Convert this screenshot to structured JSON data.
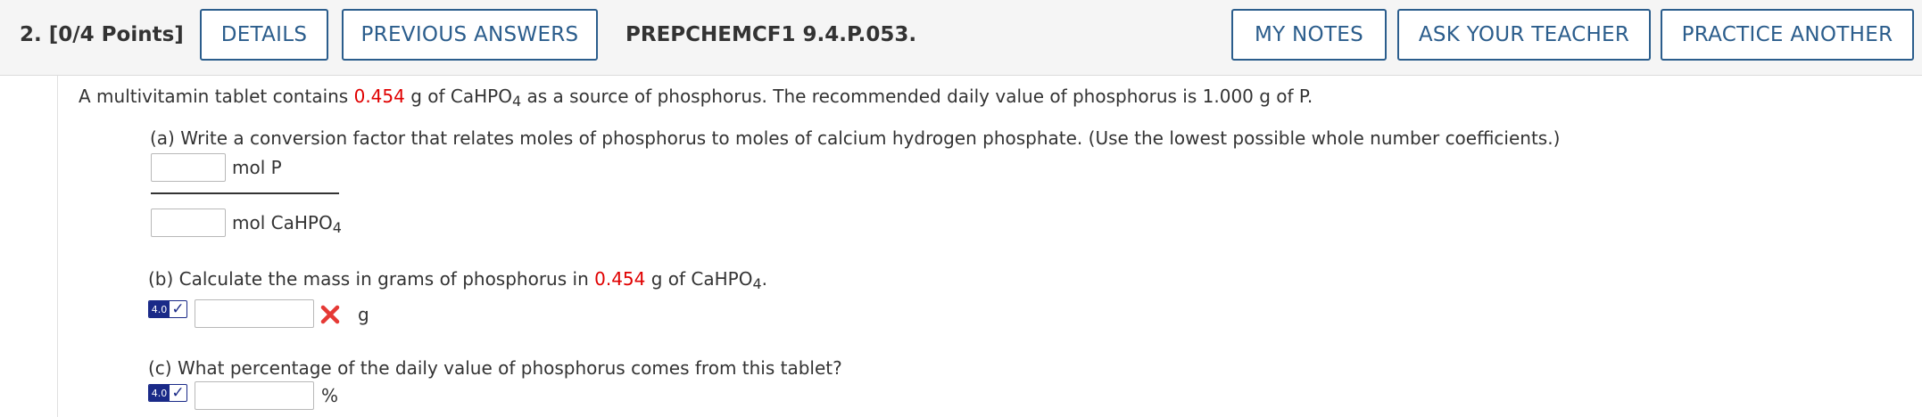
{
  "header": {
    "question_label": "2. [0/4 Points]",
    "details_button": "DETAILS",
    "previous_answers_button": "PREVIOUS ANSWERS",
    "problem_code": "PREPCHEMCF1 9.4.P.053.",
    "my_notes_button": "MY NOTES",
    "ask_teacher_button": "ASK YOUR TEACHER",
    "practice_another_button": "PRACTICE ANOTHER"
  },
  "problem": {
    "intro_pre": "A multivitamin tablet contains ",
    "mass_value": "0.454",
    "intro_mid": " g of CaHPO",
    "intro_sub": "4",
    "intro_post": " as a source of phosphorus. The recommended daily value of phosphorus is 1.000 g of P."
  },
  "part_a": {
    "prompt": "(a) Write a conversion factor that relates moles of phosphorus to moles of calcium hydrogen phosphate. (Use the lowest possible whole number coefficients.)",
    "numerator_value": "",
    "numerator_unit": "mol P",
    "denominator_value": "",
    "denominator_unit_pre": "mol CaHPO",
    "denominator_unit_sub": "4"
  },
  "part_b": {
    "prompt_pre": "(b) Calculate the mass in grams of phosphorus in ",
    "mass_value": "0.454",
    "prompt_mid": " g of CaHPO",
    "prompt_sub": "4",
    "prompt_post": ".",
    "badge_number": "4.0",
    "answer_value": "",
    "unit": "g",
    "status": "incorrect",
    "status_color": "#e53935"
  },
  "part_c": {
    "prompt": "(c) What percentage of the daily value of phosphorus comes from this tablet?",
    "badge_number": "4.0",
    "answer_value": "",
    "unit": "%"
  },
  "colors": {
    "button_border": "#2b5d8c",
    "highlight_red": "#e00000",
    "badge_navy": "#1a2a88"
  }
}
